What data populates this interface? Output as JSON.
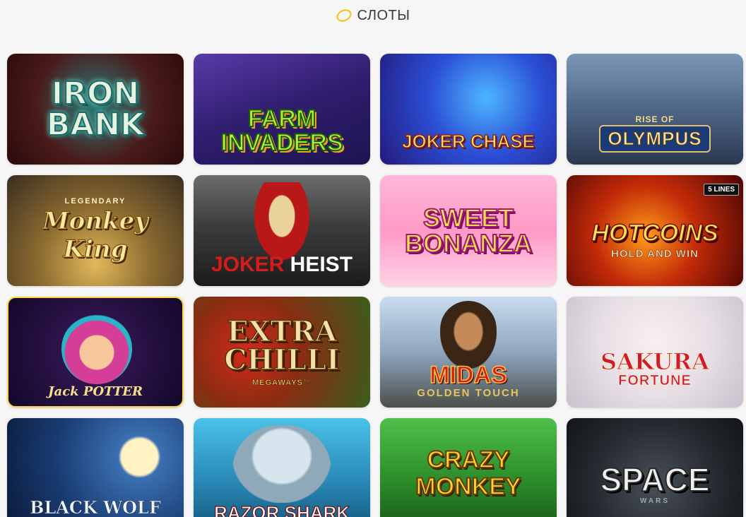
{
  "section": {
    "title": "СЛОТЫ",
    "icon": "coin-icon",
    "icon_color": "#f4c20d"
  },
  "games": [
    {
      "id": "iron-bank",
      "title": "IRON BANK"
    },
    {
      "id": "farm-invaders",
      "title": "FARM INVADERS"
    },
    {
      "id": "joker-chase",
      "title": "JOKER CHASE"
    },
    {
      "id": "rise-of-olympus",
      "title": "RISE OF",
      "subtitle": "OLYMPUS"
    },
    {
      "id": "legendary-monkey-king",
      "title": "LEGENDARY",
      "subtitle": "Monkey King"
    },
    {
      "id": "joker-heist",
      "title_part1": "JOKER",
      "title_part2": "HEIST"
    },
    {
      "id": "sweet-bonanza",
      "title": "SWEET BONANZA"
    },
    {
      "id": "hot-coins",
      "title": "HOTCOINS",
      "subtitle": "HOLD AND WIN",
      "badge": "5 LINES"
    },
    {
      "id": "jack-potter",
      "title": "Jack POTTER"
    },
    {
      "id": "extra-chilli",
      "title": "EXTRA CHILLI",
      "subtitle": "MEGAWAYS™"
    },
    {
      "id": "midas-golden-touch",
      "title": "MIDAS",
      "subtitle": "GOLDEN TOUCH"
    },
    {
      "id": "sakura-fortune",
      "title": "SAKURA",
      "subtitle": "FORTUNE"
    },
    {
      "id": "black-wolf",
      "title": "BLACK WOLF"
    },
    {
      "id": "razor-shark",
      "title": "RAZOR SHARK"
    },
    {
      "id": "crazy-monkey",
      "title": "CRAZY MONKEY"
    },
    {
      "id": "space-wars",
      "title": "SPACE",
      "subtitle": "WARS"
    }
  ]
}
